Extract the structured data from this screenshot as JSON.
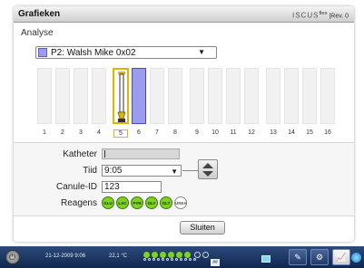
{
  "window": {
    "title": "Grafieken",
    "brand_name": "ISCUS",
    "brand_sup": "flex",
    "brand_rev": "|Rev. 0"
  },
  "analyse_label": "Analyse",
  "patient_select": {
    "value": "P2: Walsh Mike 0x02",
    "color": "#9b9bf0"
  },
  "slots": {
    "numbers": [
      "1",
      "2",
      "3",
      "4",
      "5",
      "6",
      "7",
      "8",
      "9",
      "10",
      "11",
      "12",
      "13",
      "14",
      "15",
      "16"
    ],
    "selected": "5",
    "patient_slot": "6"
  },
  "form": {
    "katheter_label": "Katheter",
    "katheter_value": "",
    "tiid_label": "Tiid",
    "tiid_value": "9:05",
    "canule_label": "Canule-ID",
    "canule_value": "123",
    "reagens_label": "Reagens",
    "reagents": [
      {
        "code": "GLU",
        "active": true
      },
      {
        "code": "LAC",
        "active": true
      },
      {
        "code": "PYR",
        "active": true
      },
      {
        "code": "GLY",
        "active": true
      },
      {
        "code": "GLT",
        "active": true
      },
      {
        "code": "UREA",
        "active": false
      }
    ]
  },
  "close_button": "Sluiten",
  "taskbar": {
    "datetime": "21-12-2009 9:06",
    "temperature": "22,1 °C",
    "box_label": "##"
  },
  "colors": {
    "accent": "#e0b400",
    "reagent_on": "#7ed321",
    "taskbar": "#1b3563"
  }
}
